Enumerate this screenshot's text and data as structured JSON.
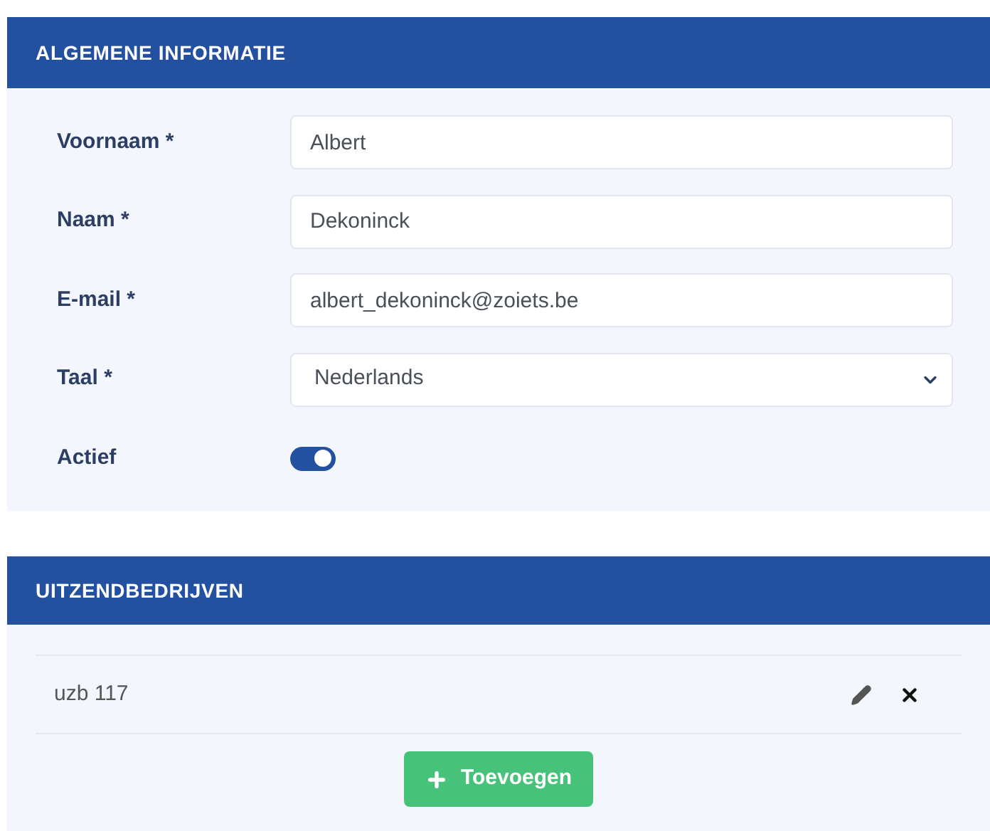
{
  "general": {
    "title": "ALGEMENE INFORMATIE",
    "fields": [
      {
        "kind": "text",
        "label": "Voornaam *",
        "value": "Albert"
      },
      {
        "kind": "text",
        "label": "Naam *",
        "value": "Dekoninck"
      },
      {
        "kind": "text",
        "label": "E-mail *",
        "value": "albert_dekoninck@zoiets.be"
      },
      {
        "kind": "select",
        "label": "Taal *",
        "value": "Nederlands"
      },
      {
        "kind": "toggle",
        "label": "Actief",
        "on": true
      }
    ]
  },
  "agencies": {
    "title": "UITZENDBEDRIJVEN",
    "items": [
      {
        "name": "uzb 117"
      }
    ],
    "add_button": "Toevoegen"
  }
}
